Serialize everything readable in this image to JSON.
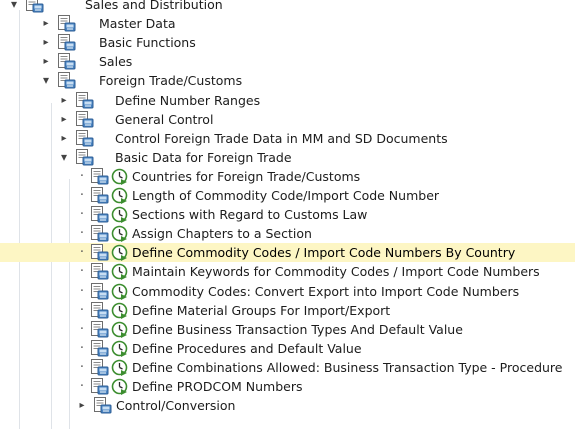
{
  "tree": {
    "nodes": [
      {
        "label": "Sales and Distribution",
        "state": "expanded",
        "kind": "folder",
        "level": 0
      },
      {
        "label": "Master Data",
        "state": "collapsed",
        "kind": "folder",
        "level": 1
      },
      {
        "label": "Basic Functions",
        "state": "collapsed",
        "kind": "folder",
        "level": 1
      },
      {
        "label": "Sales",
        "state": "collapsed",
        "kind": "folder",
        "level": 1
      },
      {
        "label": "Foreign Trade/Customs",
        "state": "expanded",
        "kind": "folder",
        "level": 1
      },
      {
        "label": "Define Number Ranges",
        "state": "collapsed",
        "kind": "folder",
        "level": 2
      },
      {
        "label": "General Control",
        "state": "collapsed",
        "kind": "folder",
        "level": 2
      },
      {
        "label": "Control Foreign Trade Data in MM and SD Documents",
        "state": "collapsed",
        "kind": "folder",
        "level": 2
      },
      {
        "label": "Basic Data for Foreign Trade",
        "state": "expanded",
        "kind": "folder",
        "level": 2
      },
      {
        "label": "Countries for Foreign Trade/Customs",
        "state": "leaf",
        "kind": "activity",
        "level": 3
      },
      {
        "label": "Length of Commodity Code/Import Code Number",
        "state": "leaf",
        "kind": "activity",
        "level": 3
      },
      {
        "label": "Sections with Regard to Customs Law",
        "state": "leaf",
        "kind": "activity",
        "level": 3
      },
      {
        "label": "Assign Chapters to a Section",
        "state": "leaf",
        "kind": "activity",
        "level": 3
      },
      {
        "label": "Define Commodity Codes / Import Code Numbers By Country",
        "state": "leaf",
        "kind": "activity",
        "level": 3,
        "selected": true
      },
      {
        "label": "Maintain Keywords for Commodity Codes / Import Code Numbers",
        "state": "leaf",
        "kind": "activity",
        "level": 3
      },
      {
        "label": "Commodity Codes: Convert Export into Import Code Numbers",
        "state": "leaf",
        "kind": "activity",
        "level": 3
      },
      {
        "label": "Define Material Groups For Import/Export",
        "state": "leaf",
        "kind": "activity",
        "level": 3
      },
      {
        "label": "Define Business Transaction Types And Default Value",
        "state": "leaf",
        "kind": "activity",
        "level": 3
      },
      {
        "label": "Define Procedures and Default Value",
        "state": "leaf",
        "kind": "activity",
        "level": 3
      },
      {
        "label": "Define Combinations Allowed: Business Transaction Type - Procedure",
        "state": "leaf",
        "kind": "activity",
        "level": 3
      },
      {
        "label": "Define PRODCOM Numbers",
        "state": "leaf",
        "kind": "activity",
        "level": 3
      },
      {
        "label": "Control/Conversion",
        "state": "collapsed",
        "kind": "folder",
        "level": 3
      }
    ]
  },
  "icons": {
    "document": "img-document-icon",
    "activity": "execute-clock-icon",
    "expanded": "triangle-down-icon",
    "collapsed": "triangle-right-icon"
  },
  "colors": {
    "selection": "#fdf6c4",
    "band": "#e8eef5",
    "icon_green": "#3c8d2f"
  }
}
